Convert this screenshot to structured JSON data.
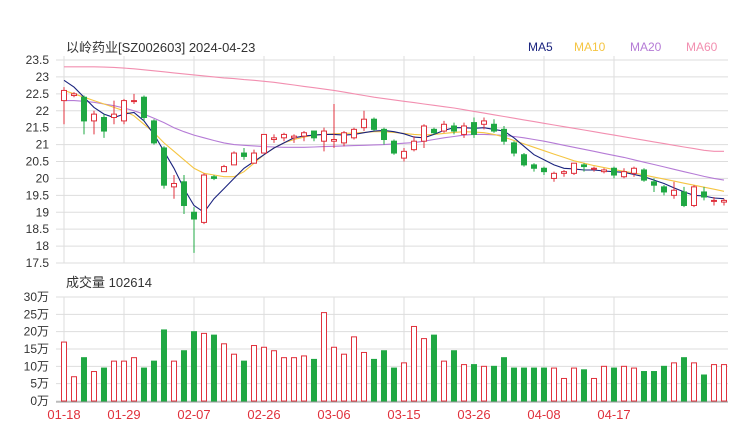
{
  "header": {
    "stock_title": "以岭药业[SZ002603] 2024-04-23",
    "volume_title": "成交量 102614"
  },
  "legend": [
    {
      "label": "MA5",
      "color": "#1a237e"
    },
    {
      "label": "MA10",
      "color": "#f5c542"
    },
    {
      "label": "MA20",
      "color": "#b57bd6"
    },
    {
      "label": "MA60",
      "color": "#f28fb0"
    }
  ],
  "colors": {
    "up": "#e0313c",
    "down": "#1fa843",
    "grid": "#dddddd",
    "xtick": "#e0313c"
  },
  "chart_data": [
    {
      "type": "candlestick",
      "title": "以岭药业[SZ002603] 2024-04-23",
      "ylim": [
        17.5,
        23.5
      ],
      "yticks": [
        "23.5",
        "23",
        "22.5",
        "22",
        "21.5",
        "21",
        "20.5",
        "20",
        "19.5",
        "19",
        "18.5",
        "18",
        "17.5"
      ],
      "x_ticks": [
        {
          "index": 0,
          "label": "01-18"
        },
        {
          "index": 6,
          "label": "01-29"
        },
        {
          "index": 13,
          "label": "02-07"
        },
        {
          "index": 20,
          "label": "02-26"
        },
        {
          "index": 27,
          "label": "03-06"
        },
        {
          "index": 34,
          "label": "03-15"
        },
        {
          "index": 41,
          "label": "03-26"
        },
        {
          "index": 48,
          "label": "04-08"
        },
        {
          "index": 55,
          "label": "04-17"
        }
      ],
      "candles": [
        [
          22.3,
          22.6,
          21.6,
          22.7
        ],
        [
          22.45,
          22.5,
          22.4,
          22.55
        ],
        [
          22.4,
          21.7,
          21.3,
          22.45
        ],
        [
          21.7,
          21.9,
          21.3,
          22.0
        ],
        [
          21.8,
          21.4,
          21.2,
          21.9
        ],
        [
          21.8,
          21.9,
          21.6,
          22.3
        ],
        [
          21.7,
          22.3,
          21.6,
          22.35
        ],
        [
          22.3,
          22.3,
          22.2,
          22.5
        ],
        [
          22.4,
          21.8,
          21.7,
          22.45
        ],
        [
          21.7,
          21.05,
          21.0,
          21.75
        ],
        [
          20.9,
          19.8,
          19.7,
          20.95
        ],
        [
          19.75,
          19.85,
          19.4,
          20.1
        ],
        [
          19.9,
          19.2,
          18.95,
          20.1
        ],
        [
          19.0,
          18.8,
          17.8,
          19.15
        ],
        [
          18.7,
          20.1,
          18.65,
          20.15
        ],
        [
          20.05,
          20.0,
          19.95,
          20.1
        ],
        [
          20.2,
          20.35,
          20.2,
          20.4
        ],
        [
          20.4,
          20.75,
          20.4,
          20.8
        ],
        [
          20.75,
          20.65,
          20.55,
          20.9
        ],
        [
          20.45,
          20.75,
          20.45,
          20.85
        ],
        [
          20.75,
          21.3,
          20.75,
          21.3
        ],
        [
          21.15,
          21.2,
          21.05,
          21.3
        ],
        [
          21.2,
          21.3,
          21.1,
          21.35
        ],
        [
          21.2,
          21.25,
          21.05,
          21.3
        ],
        [
          21.25,
          21.35,
          21.1,
          21.4
        ],
        [
          21.4,
          21.2,
          21.1,
          21.4
        ],
        [
          21.1,
          21.4,
          20.8,
          21.5
        ],
        [
          21.1,
          21.15,
          20.9,
          22.2
        ],
        [
          21.05,
          21.35,
          20.95,
          21.4
        ],
        [
          21.2,
          21.45,
          21.15,
          21.5
        ],
        [
          21.5,
          21.75,
          21.4,
          22.0
        ],
        [
          21.75,
          21.45,
          21.4,
          21.8
        ],
        [
          21.45,
          21.15,
          21.0,
          21.5
        ],
        [
          21.1,
          20.75,
          20.7,
          21.15
        ],
        [
          20.6,
          20.8,
          20.5,
          20.9
        ],
        [
          20.85,
          21.1,
          20.8,
          21.25
        ],
        [
          21.1,
          21.55,
          20.9,
          21.6
        ],
        [
          21.45,
          21.35,
          21.3,
          21.5
        ],
        [
          21.4,
          21.6,
          21.35,
          21.7
        ],
        [
          21.55,
          21.4,
          21.3,
          21.65
        ],
        [
          21.3,
          21.55,
          21.2,
          21.65
        ],
        [
          21.65,
          21.3,
          21.2,
          21.8
        ],
        [
          21.6,
          21.7,
          21.45,
          21.8
        ],
        [
          21.6,
          21.4,
          21.35,
          21.75
        ],
        [
          21.45,
          21.1,
          21.0,
          21.55
        ],
        [
          21.05,
          20.75,
          20.65,
          21.1
        ],
        [
          20.7,
          20.4,
          20.35,
          20.75
        ],
        [
          20.4,
          20.3,
          20.2,
          20.45
        ],
        [
          20.3,
          20.2,
          20.1,
          20.35
        ],
        [
          20.0,
          20.15,
          19.9,
          20.2
        ],
        [
          20.15,
          20.2,
          20.05,
          20.25
        ],
        [
          20.15,
          20.45,
          20.1,
          20.45
        ],
        [
          20.4,
          20.35,
          20.2,
          20.45
        ],
        [
          20.3,
          20.3,
          20.2,
          20.35
        ],
        [
          20.2,
          20.25,
          20.15,
          20.3
        ],
        [
          20.3,
          20.1,
          20.0,
          20.35
        ],
        [
          20.05,
          20.2,
          20.0,
          20.3
        ],
        [
          20.15,
          20.3,
          20.05,
          20.35
        ],
        [
          20.25,
          19.95,
          19.9,
          20.3
        ],
        [
          19.9,
          19.8,
          19.6,
          20.0
        ],
        [
          19.75,
          19.6,
          19.5,
          19.8
        ],
        [
          19.5,
          19.65,
          19.4,
          19.9
        ],
        [
          19.6,
          19.2,
          19.15,
          19.75
        ],
        [
          19.2,
          19.75,
          19.15,
          19.8
        ],
        [
          19.6,
          19.45,
          19.35,
          19.75
        ],
        [
          19.35,
          19.35,
          19.2,
          19.45
        ],
        [
          19.3,
          19.35,
          19.2,
          19.4
        ]
      ],
      "ma5": [
        22.9,
        22.7,
        22.4,
        22.1,
        21.9,
        21.8,
        21.9,
        21.95,
        21.7,
        21.3,
        20.8,
        20.3,
        19.7,
        19.2,
        19.0,
        19.4,
        19.7,
        20.0,
        20.3,
        20.5,
        20.7,
        20.9,
        21.05,
        21.2,
        21.25,
        21.28,
        21.3,
        21.3,
        21.28,
        21.3,
        21.35,
        21.4,
        21.42,
        21.38,
        21.32,
        21.22,
        21.2,
        21.3,
        21.42,
        21.5,
        21.5,
        21.48,
        21.5,
        21.45,
        21.4,
        21.2,
        20.95,
        20.7,
        20.55,
        20.4,
        20.3,
        20.28,
        20.25,
        20.25,
        20.22,
        20.2,
        20.18,
        20.12,
        20.05,
        19.95,
        19.85,
        19.72,
        19.6,
        19.5,
        19.48,
        19.42,
        19.4
      ],
      "ma10": [
        22.6,
        22.5,
        22.4,
        22.3,
        22.2,
        22.1,
        22.0,
        21.85,
        21.6,
        21.35,
        21.05,
        20.8,
        20.55,
        20.3,
        20.15,
        20.1,
        20.05,
        20.05,
        20.2,
        20.45,
        20.7,
        20.9,
        21.05,
        21.15,
        21.22,
        21.28,
        21.3,
        21.32,
        21.33,
        21.34,
        21.36,
        21.38,
        21.38,
        21.36,
        21.33,
        21.3,
        21.28,
        21.3,
        21.33,
        21.36,
        21.38,
        21.37,
        21.35,
        21.3,
        21.22,
        21.12,
        21.02,
        20.92,
        20.82,
        20.72,
        20.62,
        20.52,
        20.45,
        20.38,
        20.32,
        20.26,
        20.21,
        20.16,
        20.1,
        20.04,
        19.98,
        19.92,
        19.86,
        19.8,
        19.74,
        19.68,
        19.62
      ],
      "ma20": [
        22.3,
        22.3,
        22.28,
        22.25,
        22.2,
        22.15,
        22.08,
        22.0,
        21.9,
        21.78,
        21.65,
        21.5,
        21.38,
        21.28,
        21.2,
        21.12,
        21.05,
        21.0,
        20.98,
        20.96,
        20.94,
        20.93,
        20.92,
        20.92,
        20.92,
        20.93,
        20.94,
        20.95,
        20.96,
        20.97,
        20.98,
        20.99,
        21.0,
        21.02,
        21.04,
        21.06,
        21.1,
        21.15,
        21.2,
        21.24,
        21.28,
        21.3,
        21.3,
        21.29,
        21.27,
        21.24,
        21.2,
        21.15,
        21.1,
        21.04,
        20.98,
        20.92,
        20.86,
        20.8,
        20.74,
        20.68,
        20.62,
        20.55,
        20.48,
        20.41,
        20.34,
        20.27,
        20.2,
        20.13,
        20.06,
        20.0,
        19.95
      ],
      "ma60": [
        23.3,
        23.3,
        23.3,
        23.3,
        23.29,
        23.28,
        23.26,
        23.24,
        23.21,
        23.18,
        23.15,
        23.12,
        23.09,
        23.06,
        23.03,
        23.0,
        22.97,
        22.95,
        22.92,
        22.9,
        22.87,
        22.84,
        22.8,
        22.76,
        22.72,
        22.68,
        22.64,
        22.6,
        22.55,
        22.5,
        22.45,
        22.4,
        22.36,
        22.32,
        22.28,
        22.24,
        22.2,
        22.16,
        22.12,
        22.08,
        22.03,
        21.98,
        21.93,
        21.88,
        21.83,
        21.78,
        21.73,
        21.68,
        21.63,
        21.58,
        21.53,
        21.48,
        21.43,
        21.38,
        21.33,
        21.28,
        21.23,
        21.18,
        21.13,
        21.08,
        21.03,
        20.98,
        20.93,
        20.88,
        20.83,
        20.8,
        20.8
      ]
    },
    {
      "type": "bar",
      "title": "成交量 102614",
      "ylim": [
        0,
        30
      ],
      "yticks": [
        "30万",
        "25万",
        "20万",
        "15万",
        "10万",
        "5万",
        "0万"
      ],
      "volumes": [
        17.0,
        7.0,
        12.5,
        8.5,
        9.5,
        11.5,
        11.5,
        12.5,
        9.5,
        11.5,
        20.5,
        11.5,
        14.5,
        20.0,
        19.5,
        19.0,
        16.5,
        13.5,
        11.5,
        16.0,
        15.5,
        14.5,
        12.5,
        12.5,
        13.0,
        12.0,
        25.5,
        15.5,
        13.5,
        18.5,
        14.0,
        12.0,
        14.5,
        9.5,
        11.0,
        21.5,
        18.0,
        19.0,
        11.5,
        14.5,
        10.5,
        10.5,
        10.0,
        10.0,
        12.5,
        9.5,
        9.5,
        9.5,
        9.5,
        9.5,
        6.5,
        9.5,
        9.0,
        6.5,
        10.0,
        9.5,
        10.0,
        9.5,
        8.5,
        8.5,
        10.0,
        11.0,
        12.5,
        11.0,
        7.5,
        10.5,
        10.5
      ]
    }
  ]
}
